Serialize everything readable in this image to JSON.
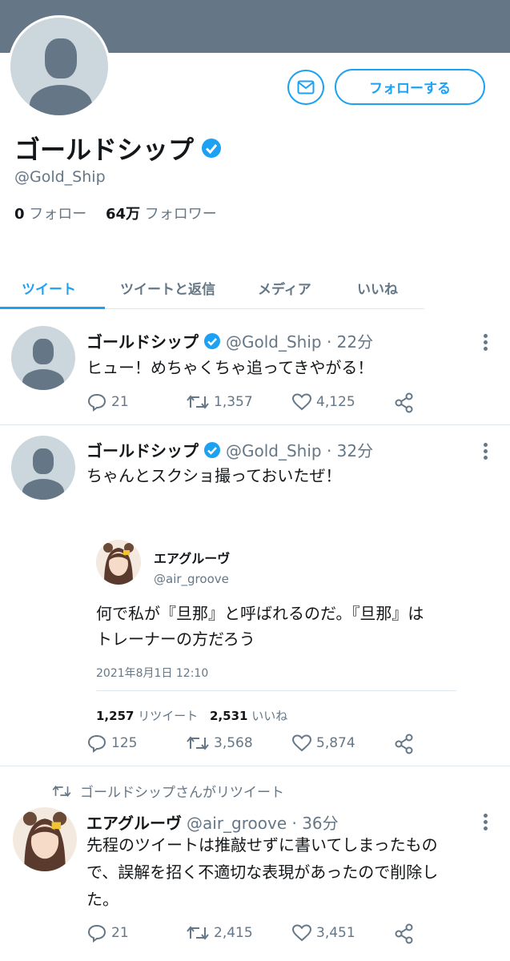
{
  "header": {
    "follow_label": "フォローする"
  },
  "profile": {
    "name": "ゴールドシップ",
    "handle": "@Gold_Ship",
    "following_count": "0",
    "following_label": "フォロー",
    "followers_count": "64万",
    "followers_label": "フォロワー"
  },
  "tabs": [
    {
      "label": "ツイート",
      "active": true
    },
    {
      "label": "ツイートと返信",
      "active": false
    },
    {
      "label": "メディア",
      "active": false
    },
    {
      "label": "いいね",
      "active": false
    }
  ],
  "colors": {
    "accent": "#1da1f2",
    "muted": "#657786",
    "banner": "#657786"
  },
  "tweets": [
    {
      "name": "ゴールドシップ",
      "meta": "@Gold_Ship · 22分",
      "text": "ヒュー！めちゃくちゃ追ってきやがる！",
      "replies": "21",
      "retweets": "1,357",
      "likes": "4,125"
    },
    {
      "name": "ゴールドシップ",
      "meta": "@Gold_Ship · 32分",
      "text": "ちゃんとスクショ撮っておいたぜ！",
      "quote": {
        "name": "エアグルーヴ",
        "handle": "@air_groove",
        "text_line1": "何で私が『旦那』と呼ばれるのだ。『旦那』は",
        "text_line2": "トレーナーの方だろう",
        "time": "2021年8月1日 12:10",
        "retweet_count": "1,257",
        "retweet_label": "リツイート",
        "like_count": "2,531",
        "like_label": "いいね"
      },
      "replies": "125",
      "retweets": "3,568",
      "likes": "5,874"
    },
    {
      "retweeted_by": "ゴールドシップさんがリツイート",
      "name": "エアグルーヴ",
      "meta": "@air_groove · 36分",
      "text_line1": "先程のツイートは推敲せずに書いてしまったもの",
      "text_line2": "で、誤解を招く不適切な表現があったので削除し",
      "text_line3": "た。",
      "replies": "21",
      "retweets": "2,415",
      "likes": "3,451"
    }
  ]
}
